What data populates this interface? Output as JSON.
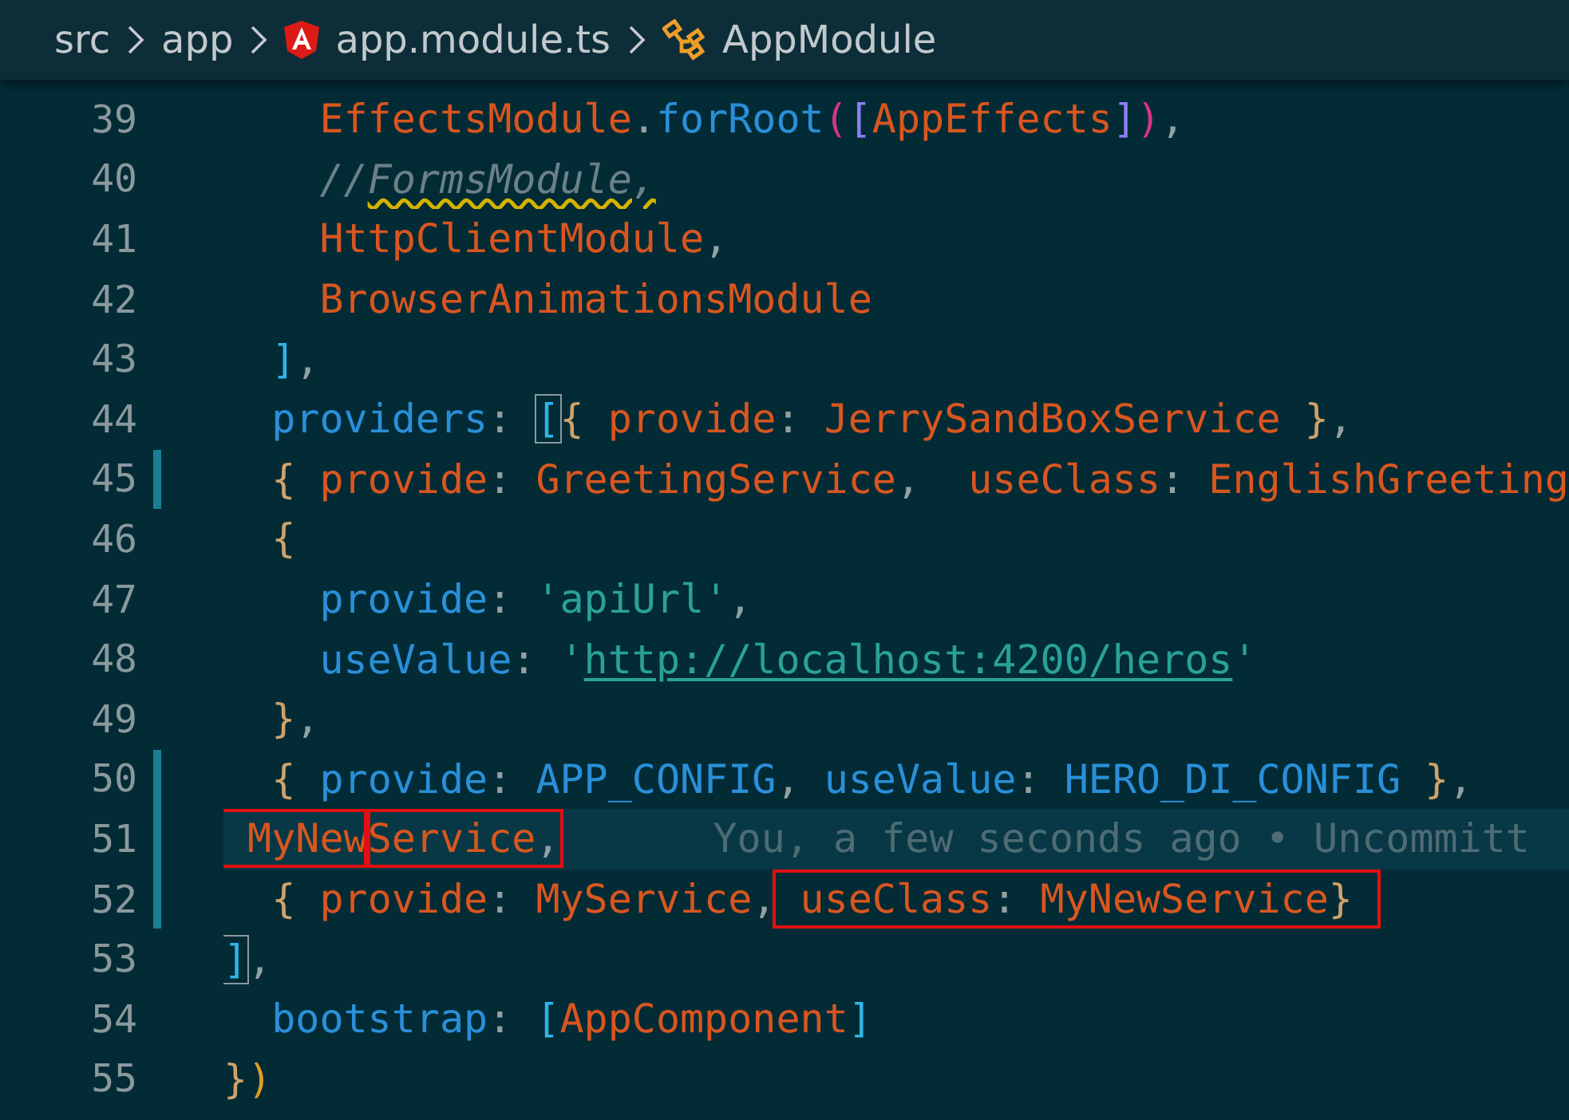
{
  "breadcrumb": [
    {
      "label": "src",
      "kind": "folder"
    },
    {
      "label": "app",
      "kind": "folder"
    },
    {
      "label": "app.module.ts",
      "kind": "file"
    },
    {
      "label": "AppModule",
      "kind": "symbol"
    }
  ],
  "editor": {
    "lines": [
      {
        "number": "39",
        "modified": false,
        "current": false,
        "tokens": [
          {
            "kind": "mod",
            "text": "    EffectsModule"
          },
          {
            "kind": "punct",
            "text": "."
          },
          {
            "kind": "prop",
            "text": "forRoot"
          },
          {
            "kind": "paren",
            "text": "("
          },
          {
            "kind": "bracket2",
            "text": "["
          },
          {
            "kind": "mod",
            "text": "AppEffects"
          },
          {
            "kind": "bracket2",
            "text": "]"
          },
          {
            "kind": "paren",
            "text": ")"
          },
          {
            "kind": "punct",
            "text": ","
          }
        ]
      },
      {
        "number": "40",
        "modified": false,
        "current": false,
        "tokens": [
          {
            "kind": "comment",
            "text": "    //"
          },
          {
            "kind": "comment",
            "text": "FormsModule,",
            "warning": true
          }
        ]
      },
      {
        "number": "41",
        "modified": false,
        "current": false,
        "tokens": [
          {
            "kind": "mod",
            "text": "    HttpClientModule"
          },
          {
            "kind": "punct",
            "text": ","
          }
        ]
      },
      {
        "number": "42",
        "modified": false,
        "current": false,
        "tokens": [
          {
            "kind": "mod",
            "text": "    BrowserAnimationsModule"
          }
        ]
      },
      {
        "number": "43",
        "modified": false,
        "current": false,
        "tokens": [
          {
            "kind": "bracket1",
            "text": "  ]"
          },
          {
            "kind": "punct",
            "text": ","
          }
        ]
      },
      {
        "number": "44",
        "modified": false,
        "current": false,
        "tokens": [
          {
            "kind": "prop",
            "text": "  providers"
          },
          {
            "kind": "punct",
            "text": ": "
          },
          {
            "kind": "bracket1",
            "text": "[",
            "matched": true
          },
          {
            "kind": "brace",
            "text": "{ "
          },
          {
            "kind": "mod",
            "text": "provide"
          },
          {
            "kind": "punct",
            "text": ": "
          },
          {
            "kind": "mod",
            "text": "JerrySandBoxService"
          },
          {
            "kind": "brace",
            "text": " }"
          },
          {
            "kind": "punct",
            "text": ","
          }
        ]
      },
      {
        "number": "45",
        "modified": true,
        "current": false,
        "tokens": [
          {
            "kind": "brace",
            "text": "  { "
          },
          {
            "kind": "mod",
            "text": "provide"
          },
          {
            "kind": "punct",
            "text": ": "
          },
          {
            "kind": "mod",
            "text": "GreetingService"
          },
          {
            "kind": "punct",
            "text": ",  "
          },
          {
            "kind": "mod",
            "text": "useClass"
          },
          {
            "kind": "punct",
            "text": ": "
          },
          {
            "kind": "mod",
            "text": "EnglishGreeting"
          }
        ]
      },
      {
        "number": "46",
        "modified": false,
        "current": false,
        "tokens": [
          {
            "kind": "brace",
            "text": "  {"
          }
        ]
      },
      {
        "number": "47",
        "modified": false,
        "current": false,
        "tokens": [
          {
            "kind": "prop",
            "text": "    provide"
          },
          {
            "kind": "punct",
            "text": ": "
          },
          {
            "kind": "string",
            "text": "'apiUrl'"
          },
          {
            "kind": "punct",
            "text": ","
          }
        ]
      },
      {
        "number": "48",
        "modified": false,
        "current": false,
        "tokens": [
          {
            "kind": "prop",
            "text": "    useValue"
          },
          {
            "kind": "punct",
            "text": ": "
          },
          {
            "kind": "string",
            "text": "'"
          },
          {
            "kind": "link",
            "text": "http://localhost:4200/heros"
          },
          {
            "kind": "string",
            "text": "'"
          }
        ]
      },
      {
        "number": "49",
        "modified": false,
        "current": false,
        "tokens": [
          {
            "kind": "brace",
            "text": "  }"
          },
          {
            "kind": "punct",
            "text": ","
          }
        ]
      },
      {
        "number": "50",
        "modified": true,
        "current": false,
        "tokens": [
          {
            "kind": "brace",
            "text": "  { "
          },
          {
            "kind": "prop",
            "text": "provide"
          },
          {
            "kind": "punct",
            "text": ": "
          },
          {
            "kind": "prop",
            "text": "APP_CONFIG"
          },
          {
            "kind": "punct",
            "text": ", "
          },
          {
            "kind": "prop",
            "text": "useValue"
          },
          {
            "kind": "punct",
            "text": ": "
          },
          {
            "kind": "prop",
            "text": "HERO_DI_CONFIG"
          },
          {
            "kind": "brace",
            "text": " }"
          },
          {
            "kind": "punct",
            "text": ","
          }
        ]
      },
      {
        "number": "51",
        "modified": true,
        "current": true,
        "blame": "You, a few seconds ago • Uncommitt",
        "tokens": [
          {
            "kind": "box",
            "tokens": [
              {
                "kind": "mod",
                "text": " MyNew"
              }
            ]
          },
          {
            "kind": "box",
            "tokens": [
              {
                "kind": "mod",
                "text": "Service"
              },
              {
                "kind": "punct",
                "text": ","
              }
            ]
          }
        ]
      },
      {
        "number": "52",
        "modified": true,
        "current": false,
        "tokens": [
          {
            "kind": "brace",
            "text": "  { "
          },
          {
            "kind": "mod",
            "text": "provide"
          },
          {
            "kind": "punct",
            "text": ": "
          },
          {
            "kind": "mod",
            "text": "MyService"
          },
          {
            "kind": "punct",
            "text": ","
          },
          {
            "kind": "box",
            "tokens": [
              {
                "kind": "mod",
                "text": " useClass"
              },
              {
                "kind": "punct",
                "text": ": "
              },
              {
                "kind": "mod",
                "text": "MyNewService"
              },
              {
                "kind": "brace",
                "text": "} "
              }
            ]
          }
        ]
      },
      {
        "number": "53",
        "modified": false,
        "current": false,
        "tokens": [
          {
            "kind": "bracket1",
            "text": "]",
            "matched": true
          },
          {
            "kind": "punct",
            "text": ","
          }
        ]
      },
      {
        "number": "54",
        "modified": false,
        "current": false,
        "tokens": [
          {
            "kind": "prop",
            "text": "  bootstrap"
          },
          {
            "kind": "punct",
            "text": ": "
          },
          {
            "kind": "bracket1",
            "text": "["
          },
          {
            "kind": "mod",
            "text": "AppComponent"
          },
          {
            "kind": "bracket1",
            "text": "]"
          }
        ]
      },
      {
        "number": "55",
        "modified": false,
        "current": false,
        "tokens": [
          {
            "kind": "brace",
            "text": "}"
          },
          {
            "kind": "paren2",
            "text": ")"
          }
        ]
      }
    ]
  }
}
